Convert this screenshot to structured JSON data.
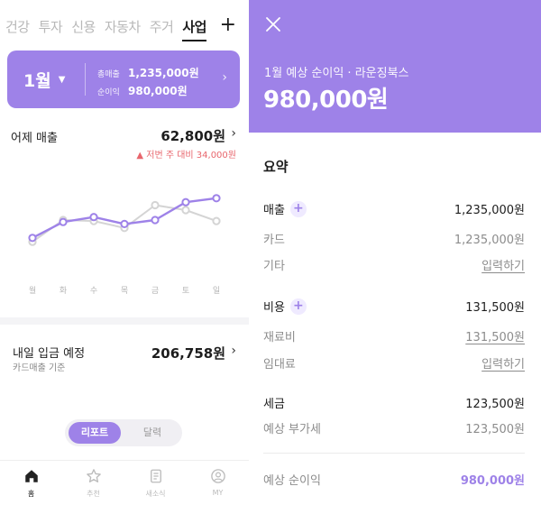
{
  "left": {
    "tabs": [
      "건강",
      "투자",
      "신용",
      "자동차",
      "주거",
      "사업"
    ],
    "active_tab": "사업",
    "tab_plus": "+",
    "summary": {
      "month": "1월",
      "revenue_label": "총매출",
      "revenue_value": "1,235,000원",
      "profit_label": "순이익",
      "profit_value": "980,000원"
    },
    "yesterday": {
      "label": "어제 매출",
      "value": "62,800원",
      "delta": "▲ 저번 주 대비 34,000원"
    },
    "deposit": {
      "label": "내일 입금 예정",
      "sub": "카드매출 기준",
      "value": "206,758원"
    },
    "toggle": {
      "on": "리포트",
      "off": "달력"
    },
    "nav": [
      {
        "label": "홈",
        "icon": "home-icon"
      },
      {
        "label": "추천",
        "icon": "star-icon"
      },
      {
        "label": "새소식",
        "icon": "news-icon"
      },
      {
        "label": "MY",
        "icon": "person-icon"
      }
    ]
  },
  "right": {
    "hero": {
      "subtitle": "1월 예상 순이익 · 라운징북스",
      "value": "980,000원"
    },
    "section_title": "요약",
    "rows": [
      {
        "key": "매출",
        "value": "1,235,000원",
        "plus": true,
        "style": "main"
      },
      {
        "key": "카드",
        "value": "1,235,000원",
        "style": "sub"
      },
      {
        "key": "기타",
        "value": "입력하기",
        "style": "link"
      },
      {
        "key": "비용",
        "value": "131,500원",
        "plus": true,
        "style": "main"
      },
      {
        "key": "재료비",
        "value": "131,500원",
        "style": "link"
      },
      {
        "key": "임대료",
        "value": "입력하기",
        "style": "link"
      },
      {
        "key": "세금",
        "value": "123,500원",
        "style": "main"
      },
      {
        "key": "예상 부가세",
        "value": "123,500원",
        "style": "sub"
      },
      {
        "key": "예상 순이익",
        "value": "980,000원",
        "style": "accent"
      }
    ]
  },
  "chart_data": {
    "type": "line",
    "categories": [
      "월",
      "화",
      "수",
      "목",
      "금",
      "토",
      "일"
    ],
    "series": [
      {
        "values": [
          42,
          58,
          63,
          56,
          60,
          78,
          82
        ],
        "color": "#9e82e8"
      },
      {
        "values": [
          38,
          60,
          59,
          52,
          75,
          70,
          59
        ],
        "color": "#d4d4d4"
      }
    ],
    "ylim": [
      0,
      100
    ],
    "grid": false
  },
  "colors": {
    "accent": "#9e82e8",
    "delta_red": "#e8666d"
  }
}
